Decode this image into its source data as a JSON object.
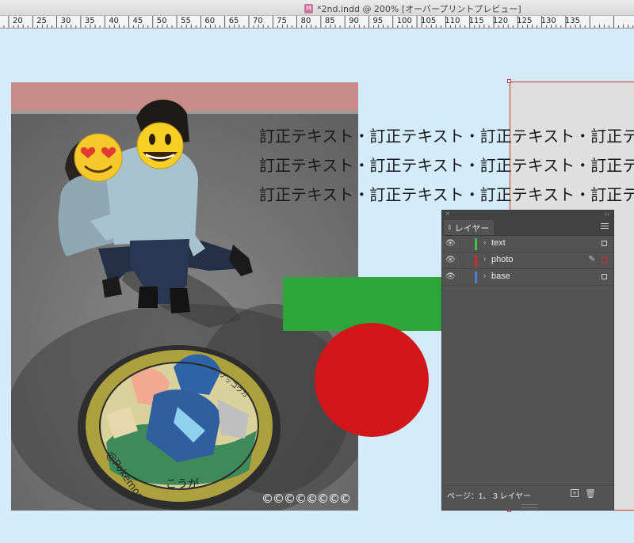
{
  "window": {
    "title": "*2nd.indd @ 200% [オーバープリントプレビュー]",
    "doc_icon_letter": "M"
  },
  "ruler": {
    "labels": [
      "20",
      "25",
      "30",
      "35",
      "40",
      "45",
      "50",
      "55",
      "60",
      "65",
      "70",
      "75",
      "80",
      "85",
      "90",
      "95",
      "100",
      "105",
      "110",
      "115",
      "120",
      "125",
      "130",
      "135"
    ]
  },
  "document": {
    "text_lines": [
      "訂正テキスト・訂正テキスト・訂正テキスト・訂正テキスト",
      "訂正テキスト・訂正テキスト・訂正テキスト・訂正テキスト",
      "訂正テキスト・訂正テキスト・訂正テキスト・訂正テキスト"
    ],
    "photo_copyright": "©©©©©©©©",
    "manhole_text_left": "@Pokemon",
    "manhole_text_bottom": "こうが",
    "manhole_text_top": "ゲッコウガ",
    "shape_colors": {
      "green": "#2aa63a",
      "red": "#d2161a"
    }
  },
  "layers_panel": {
    "tab_label": "レイヤー",
    "layers": [
      {
        "name": "text",
        "color": "#3fc83f",
        "active": false
      },
      {
        "name": "photo",
        "color": "#d62a2a",
        "active": true
      },
      {
        "name": "base",
        "color": "#4a7fd6",
        "active": false
      }
    ],
    "footer_status": "ページ：1、 3 レイヤー"
  }
}
